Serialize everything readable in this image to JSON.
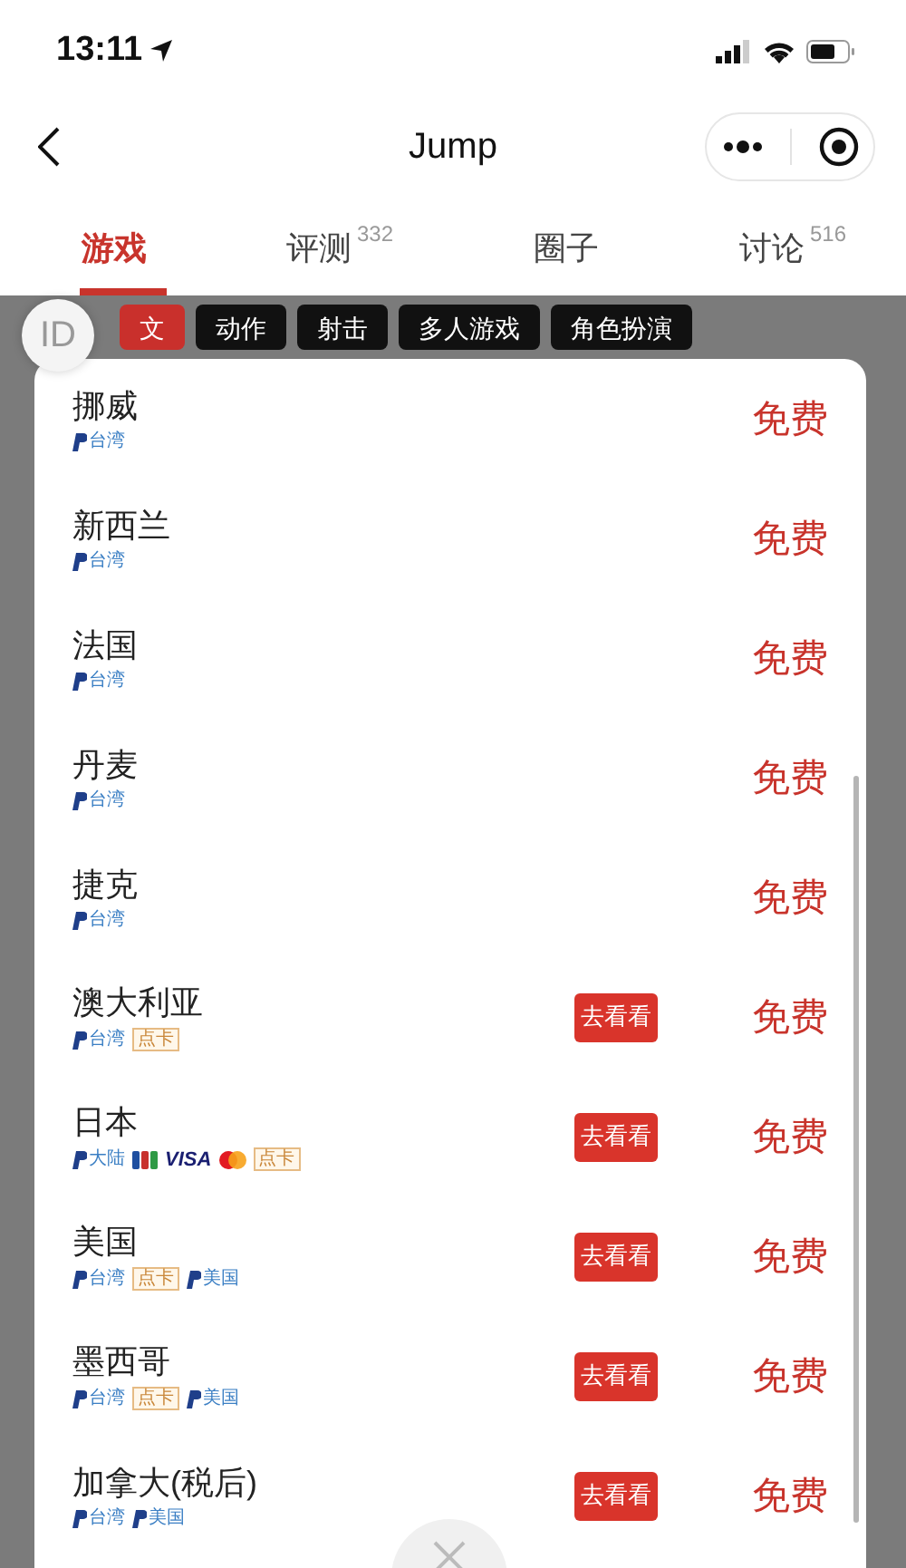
{
  "status_bar": {
    "time": "13:11"
  },
  "nav": {
    "title": "Jump"
  },
  "tabs": [
    {
      "label": "游戏",
      "selected": true
    },
    {
      "label": "评测",
      "count": "332",
      "selected": false
    },
    {
      "label": "圈子",
      "selected": false
    },
    {
      "label": "讨论",
      "count": "516",
      "selected": false
    }
  ],
  "floating_button": {
    "label": "ID"
  },
  "categories": [
    {
      "label": "文",
      "selected": true
    },
    {
      "label": "动作",
      "selected": false
    },
    {
      "label": "射击",
      "selected": false
    },
    {
      "label": "多人游戏",
      "selected": false
    },
    {
      "label": "角色扮演",
      "selected": false
    }
  ],
  "prices": [
    {
      "name": "挪威",
      "payments": [
        {
          "kind": "paypal",
          "label": "台湾"
        }
      ],
      "price": "免费"
    },
    {
      "name": "新西兰",
      "payments": [
        {
          "kind": "paypal",
          "label": "台湾"
        }
      ],
      "price": "免费"
    },
    {
      "name": "法国",
      "payments": [
        {
          "kind": "paypal",
          "label": "台湾"
        }
      ],
      "price": "免费"
    },
    {
      "name": "丹麦",
      "payments": [
        {
          "kind": "paypal",
          "label": "台湾"
        }
      ],
      "price": "免费"
    },
    {
      "name": "捷克",
      "payments": [
        {
          "kind": "paypal",
          "label": "台湾"
        }
      ],
      "price": "免费"
    },
    {
      "name": "澳大利亚",
      "payments": [
        {
          "kind": "paypal",
          "label": "台湾"
        },
        {
          "kind": "tag",
          "label": "点卡"
        }
      ],
      "action": "去看看",
      "price": "免费"
    },
    {
      "name": "日本",
      "payments": [
        {
          "kind": "paypal",
          "label": "大陆"
        },
        {
          "kind": "jcb"
        },
        {
          "kind": "visa",
          "label": "VISA"
        },
        {
          "kind": "mastercard"
        },
        {
          "kind": "tag",
          "label": "点卡"
        }
      ],
      "action": "去看看",
      "price": "免费"
    },
    {
      "name": "美国",
      "payments": [
        {
          "kind": "paypal",
          "label": "台湾"
        },
        {
          "kind": "tag",
          "label": "点卡"
        },
        {
          "kind": "paypal",
          "label": "美国"
        }
      ],
      "action": "去看看",
      "price": "免费"
    },
    {
      "name": "墨西哥",
      "payments": [
        {
          "kind": "paypal",
          "label": "台湾"
        },
        {
          "kind": "tag",
          "label": "点卡"
        },
        {
          "kind": "paypal",
          "label": "美国"
        }
      ],
      "action": "去看看",
      "price": "免费"
    },
    {
      "name": "加拿大(税后)",
      "payments": [
        {
          "kind": "paypal",
          "label": "台湾"
        },
        {
          "kind": "paypal",
          "label": "美国"
        }
      ],
      "action": "去看看",
      "price": "免费"
    }
  ]
}
